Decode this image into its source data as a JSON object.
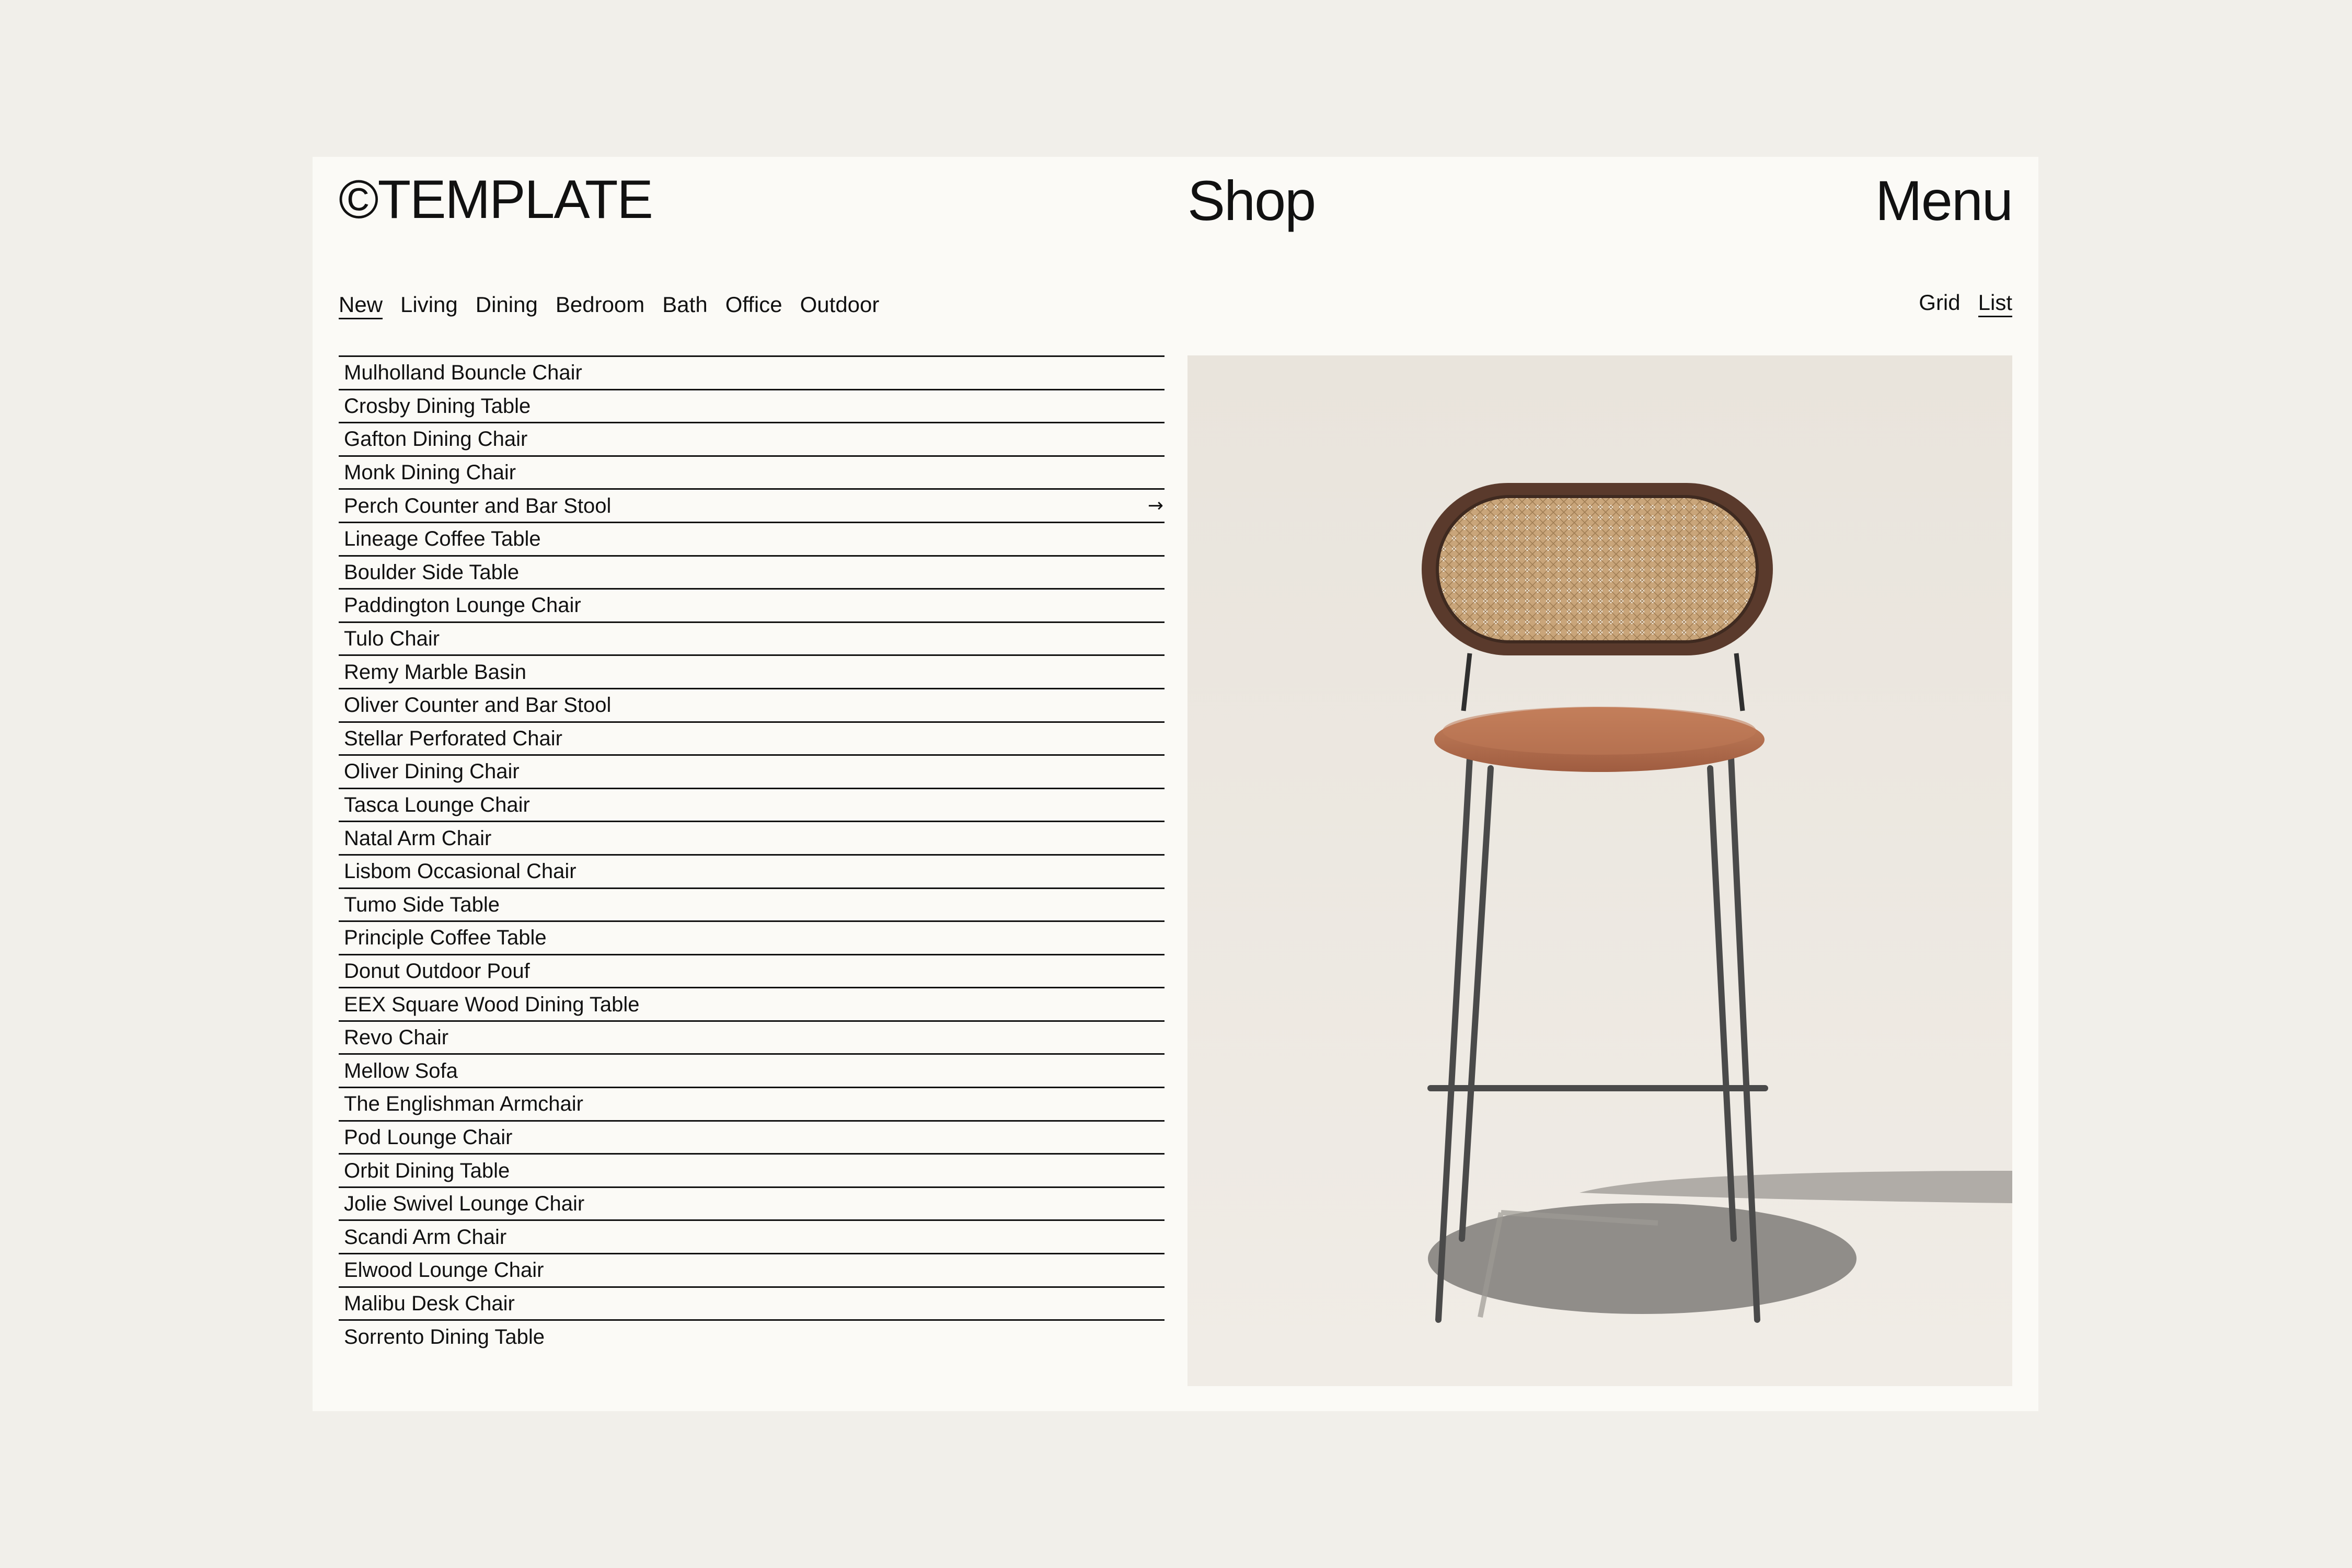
{
  "header": {
    "logo": "©TEMPLATE",
    "title": "Shop",
    "menu_label": "Menu"
  },
  "categories": [
    {
      "label": "New",
      "active": true
    },
    {
      "label": "Living",
      "active": false
    },
    {
      "label": "Dining",
      "active": false
    },
    {
      "label": "Bedroom",
      "active": false
    },
    {
      "label": "Bath",
      "active": false
    },
    {
      "label": "Office",
      "active": false
    },
    {
      "label": "Outdoor",
      "active": false
    }
  ],
  "view_toggle": {
    "grid_label": "Grid",
    "list_label": "List",
    "selected": "List"
  },
  "products": [
    "Mulholland Bouncle Chair",
    "Crosby Dining Table",
    "Gafton Dining Chair",
    "Monk Dining Chair",
    "Perch Counter and Bar Stool",
    "Lineage Coffee Table",
    "Boulder Side Table",
    "Paddington Lounge Chair",
    "Tulo Chair",
    "Remy Marble Basin",
    "Oliver Counter and Bar Stool",
    "Stellar Perforated Chair",
    "Oliver Dining Chair",
    "Tasca Lounge Chair",
    "Natal Arm Chair",
    "Lisbom Occasional Chair",
    "Tumo Side Table",
    "Principle Coffee Table",
    "Donut Outdoor Pouf",
    "EEX Square Wood Dining Table",
    "Revo Chair",
    "Mellow Sofa",
    "The Englishman Armchair",
    "Pod Lounge Chair",
    "Orbit Dining Table",
    "Jolie Swivel Lounge Chair",
    "Scandi Arm Chair",
    "Elwood Lounge Chair",
    "Malibu Desk Chair",
    "Sorrento Dining Table"
  ],
  "hovered_product": "Perch Counter and Bar Stool",
  "row_arrow_icon": "arrow-right-icon",
  "colors": {
    "page_background": "#f1efea",
    "panel_background": "#fbfaf6",
    "text": "#111111",
    "photo_background": "#ece8e2",
    "cane": "#c9a57a",
    "frame": "#5a3a2c",
    "seat": "#b87353"
  }
}
